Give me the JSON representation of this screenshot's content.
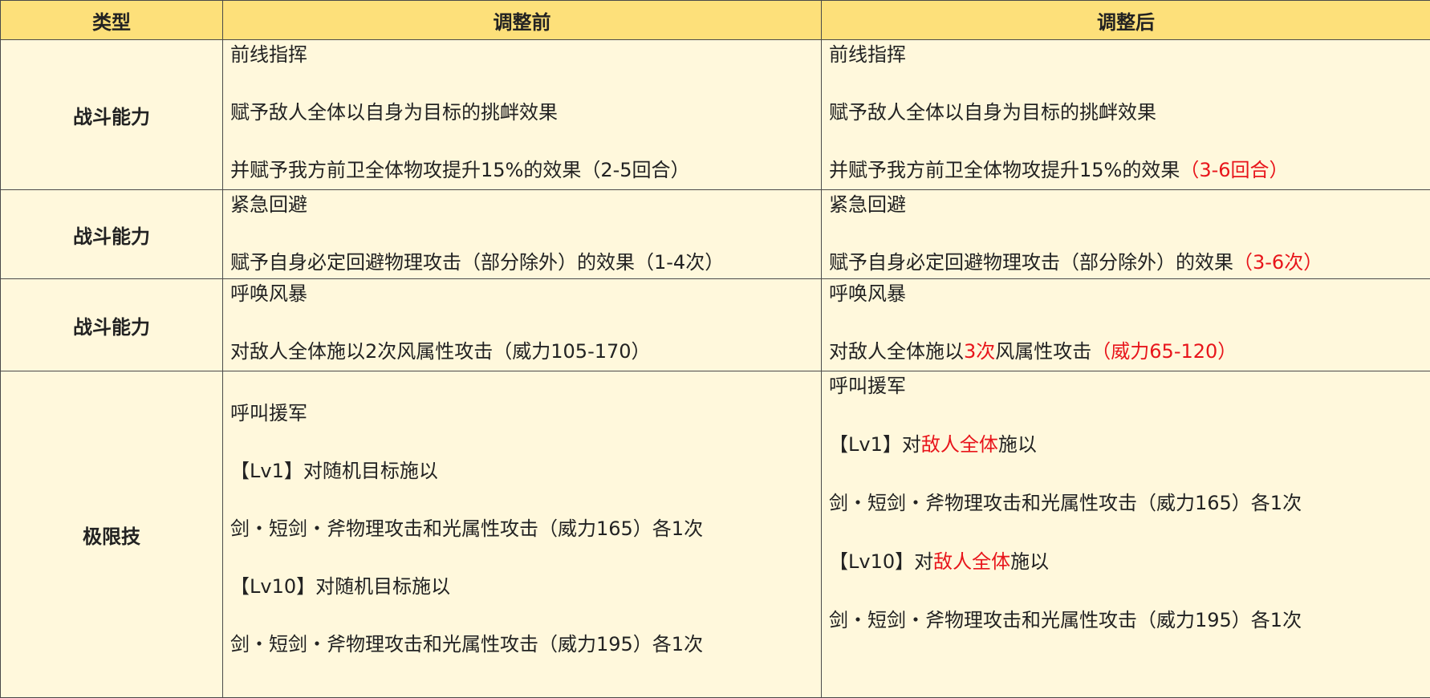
{
  "header": {
    "col_type": "类型",
    "col_before": "调整前",
    "col_after": "调整后"
  },
  "rows": [
    {
      "type": "战斗能力",
      "before": [
        "前线指挥",
        "赋予敌人全体以自身为目标的挑衅效果",
        "并赋予我方前卫全体物攻提升15%的效果（2-5回合）"
      ],
      "after": {
        "l1": "前线指挥",
        "l2": "赋予敌人全体以自身为目标的挑衅效果",
        "l3_normal": "并赋予我方前卫全体物攻提升15%的效果",
        "l3_red": "（3-6回合）"
      }
    },
    {
      "type": "战斗能力",
      "before": [
        "紧急回避",
        "赋予自身必定回避物理攻击（部分除外）的效果（1-4次）"
      ],
      "after": {
        "l1": "紧急回避",
        "l2_normal": "赋予自身必定回避物理攻击（部分除外）的效果",
        "l2_red": "（3-6次）"
      }
    },
    {
      "type": "战斗能力",
      "before": [
        "呼唤风暴",
        "对敌人全体施以2次风属性攻击（威力105-170）"
      ],
      "after": {
        "l1": "呼唤风暴",
        "l2_a": "对敌人全体施以",
        "l2_red1": "3次",
        "l2_b": "风属性攻击",
        "l2_red2": "（威力65-120）"
      }
    },
    {
      "type": "极限技",
      "before": [
        "呼叫援军",
        "【Lv1】对随机目标施以",
        "剑・短剑・斧物理攻击和光属性攻击（威力165）各1次",
        "【Lv10】对随机目标施以",
        "剑・短剑・斧物理攻击和光属性攻击（威力195）各1次"
      ],
      "after": {
        "l1": "呼叫援军",
        "l2_a": "【Lv1】对",
        "l2_red": "敌人全体",
        "l2_b": "施以",
        "l3": "剑・短剑・斧物理攻击和光属性攻击（威力165）各1次",
        "l4_a": "【Lv10】对",
        "l4_red": "敌人全体",
        "l4_b": "施以",
        "l5": "剑・短剑・斧物理攻击和光属性攻击（威力195）各1次"
      }
    }
  ]
}
